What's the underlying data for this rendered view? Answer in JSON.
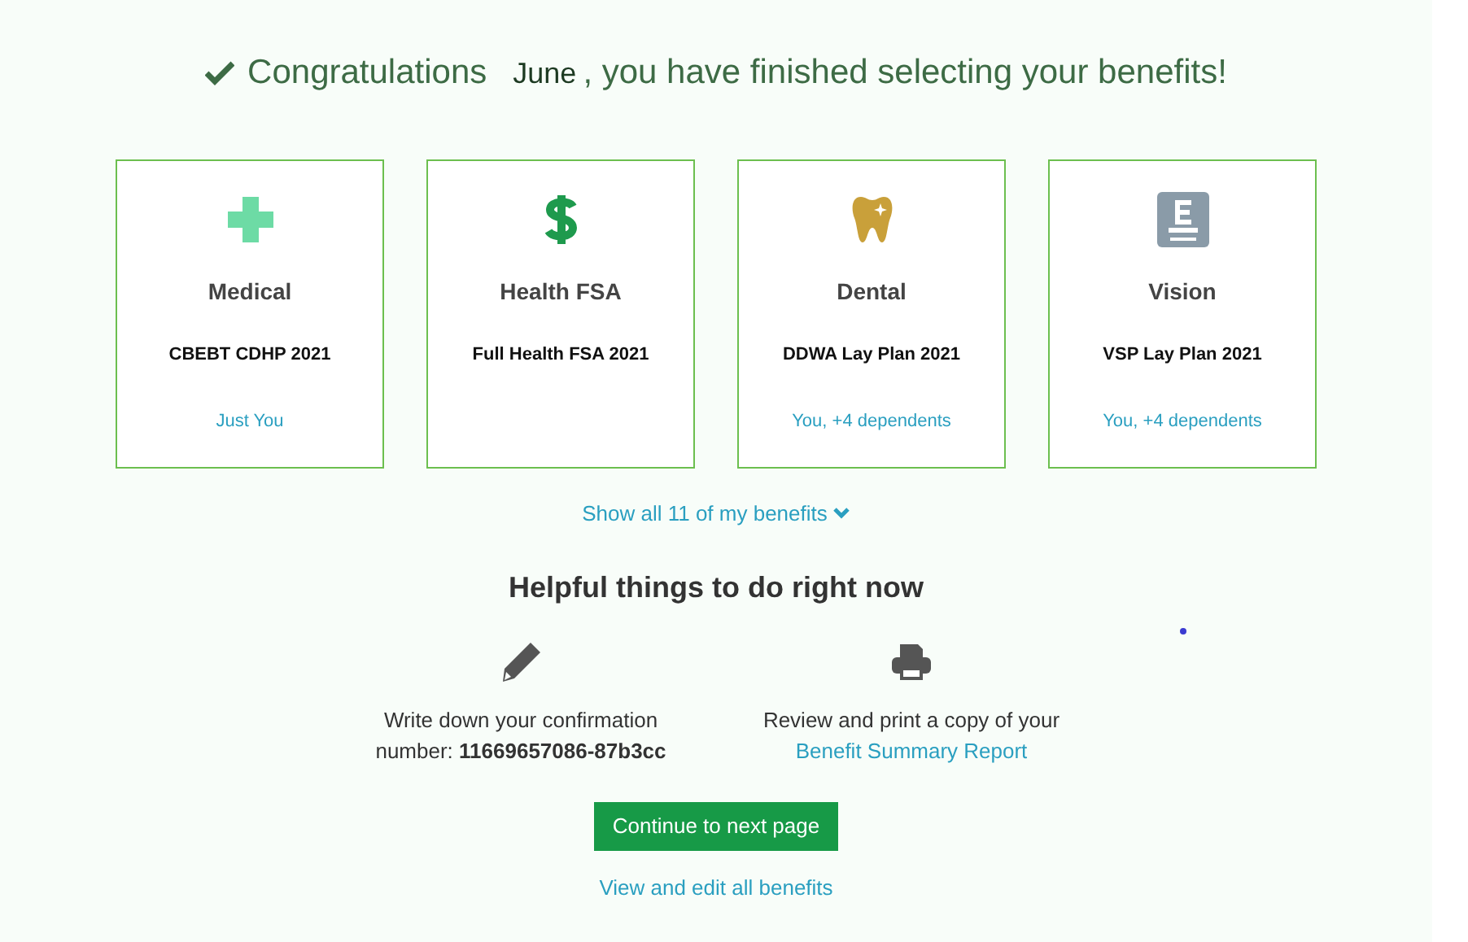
{
  "heading": {
    "prefix": "Congratulations",
    "name": "June",
    "suffix": ", you have finished selecting your benefits!"
  },
  "benefits": [
    {
      "kind": "medical",
      "title": "Medical",
      "plan": "CBEBT CDHP 2021",
      "coverage": "Just You"
    },
    {
      "kind": "fsa",
      "title": "Health FSA",
      "plan": "Full Health FSA 2021"
    },
    {
      "kind": "dental",
      "title": "Dental",
      "plan": "DDWA Lay Plan 2021",
      "coverage": "You, +4 dependents"
    },
    {
      "kind": "vision",
      "title": "Vision",
      "plan": "VSP Lay Plan 2021",
      "coverage": "You, +4 dependents"
    }
  ],
  "show_all_link": "Show all 11 of my benefits",
  "helpful": {
    "title": "Helpful things to do right now",
    "tasks": [
      {
        "kind": "write",
        "text": "Write down your confirmation number: **11669657086-87b3cc**"
      },
      {
        "kind": "print",
        "text": "Review and print a copy of your",
        "link": "Benefit Summary Report"
      }
    ]
  },
  "continue_button": "Continue to next page",
  "edit_link": "View and edit all benefits"
}
